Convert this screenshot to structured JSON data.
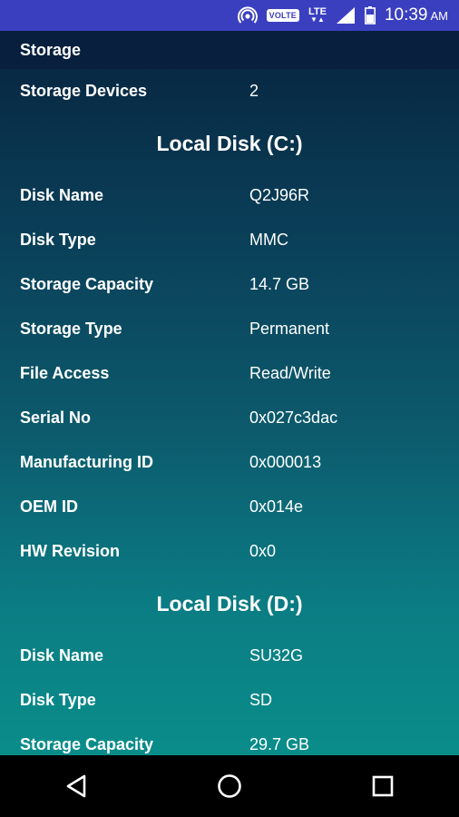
{
  "status_bar": {
    "volte": "VOLTE",
    "lte": "LTE",
    "time": "10:39",
    "ampm": "AM",
    "icons": [
      "hotspot-icon",
      "signal-icon",
      "battery-icon"
    ]
  },
  "screen": {
    "title": "Storage",
    "devices_label": "Storage Devices",
    "devices_value": "2"
  },
  "disks": [
    {
      "title": "Local Disk (C:)",
      "rows": [
        {
          "label": "Disk Name",
          "value": "Q2J96R"
        },
        {
          "label": "Disk Type",
          "value": "MMC"
        },
        {
          "label": "Storage Capacity",
          "value": "14.7 GB"
        },
        {
          "label": "Storage Type",
          "value": "Permanent"
        },
        {
          "label": "File Access",
          "value": "Read/Write"
        },
        {
          "label": "Serial No",
          "value": "0x027c3dac"
        },
        {
          "label": "Manufacturing ID",
          "value": "0x000013"
        },
        {
          "label": "OEM ID",
          "value": "0x014e"
        },
        {
          "label": "HW Revision",
          "value": "0x0"
        }
      ]
    },
    {
      "title": "Local Disk (D:)",
      "rows": [
        {
          "label": "Disk Name",
          "value": "SU32G"
        },
        {
          "label": "Disk Type",
          "value": "SD"
        },
        {
          "label": "Storage Capacity",
          "value": "29.7 GB"
        }
      ]
    }
  ],
  "nav_bar": {
    "buttons": [
      "back-icon",
      "home-icon",
      "recents-icon"
    ]
  }
}
